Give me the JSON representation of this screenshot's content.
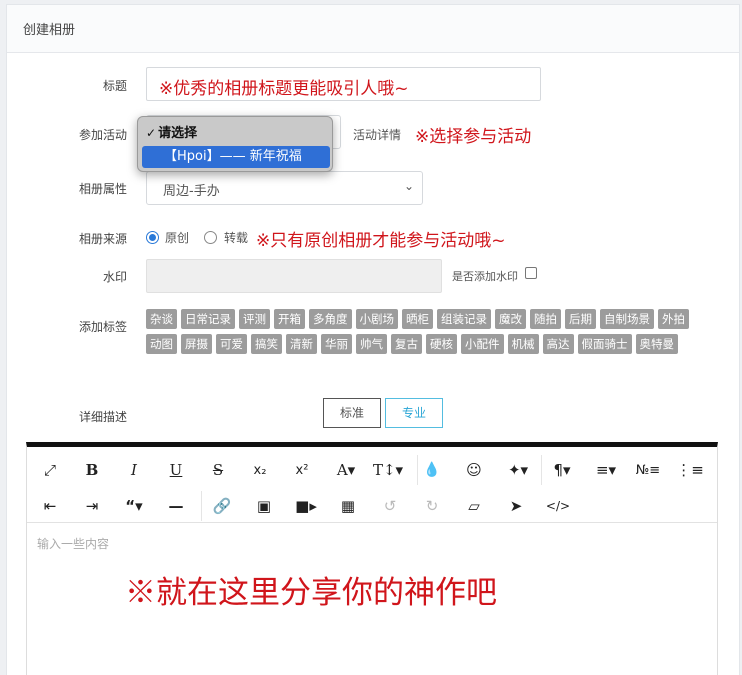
{
  "header": {
    "title": "创建相册"
  },
  "form": {
    "title_label": "标题",
    "title_hint": "※优秀的相册标题更能吸引人哦~",
    "activity_label": "参加活动",
    "activity_detail_label": "活动详情",
    "activity_hint": "※选择参与活动",
    "activity_options": [
      "请选择",
      "【Hpoi】—— 新年祝福"
    ],
    "property_label": "相册属性",
    "property_value": "周边-手办",
    "source_label": "相册来源",
    "source_options": [
      "原创",
      "转载"
    ],
    "source_selected": "原创",
    "source_hint": "※只有原创相册才能参与活动哦~",
    "watermark_label": "水印",
    "watermark_check_label": "是否添加水印",
    "tags_label": "添加标签",
    "tags": [
      "杂谈",
      "日常记录",
      "评测",
      "开箱",
      "多角度",
      "小剧场",
      "晒柜",
      "组装记录",
      "魔改",
      "随拍",
      "后期",
      "自制场景",
      "外拍",
      "动图",
      "屏摄",
      "可爱",
      "搞笑",
      "清新",
      "华丽",
      "帅气",
      "复古",
      "硬核",
      "小配件",
      "机械",
      "高达",
      "假面骑士",
      "奥特曼"
    ],
    "description_label": "详细描述",
    "mode_standard": "标准",
    "mode_pro": "专业"
  },
  "editor": {
    "toolbar_row1": [
      "fullscreen-icon",
      "bold-icon",
      "italic-icon",
      "underline-icon",
      "strikethrough-icon",
      "subscript-icon",
      "superscript-icon",
      "font-size-icon",
      "text-height-icon",
      "color-icon",
      "emoji-icon",
      "magic-icon",
      "paragraph-icon",
      "align-icon",
      "ordered-list-icon",
      "unordered-list-icon"
    ],
    "toolbar_row2": [
      "outdent-icon",
      "indent-icon",
      "quote-icon",
      "horizontal-rule-icon",
      "link-icon",
      "image-icon",
      "video-icon",
      "table-icon",
      "undo-icon",
      "redo-icon",
      "eraser-icon",
      "select-icon",
      "code-view-icon"
    ],
    "placeholder": "输入一些内容",
    "hint": "※就在这里分享你的神作吧"
  },
  "colors": {
    "accent_red": "#d0151b",
    "highlight_blue": "#2f6fd6",
    "tag_gray": "#9c9c9c"
  }
}
